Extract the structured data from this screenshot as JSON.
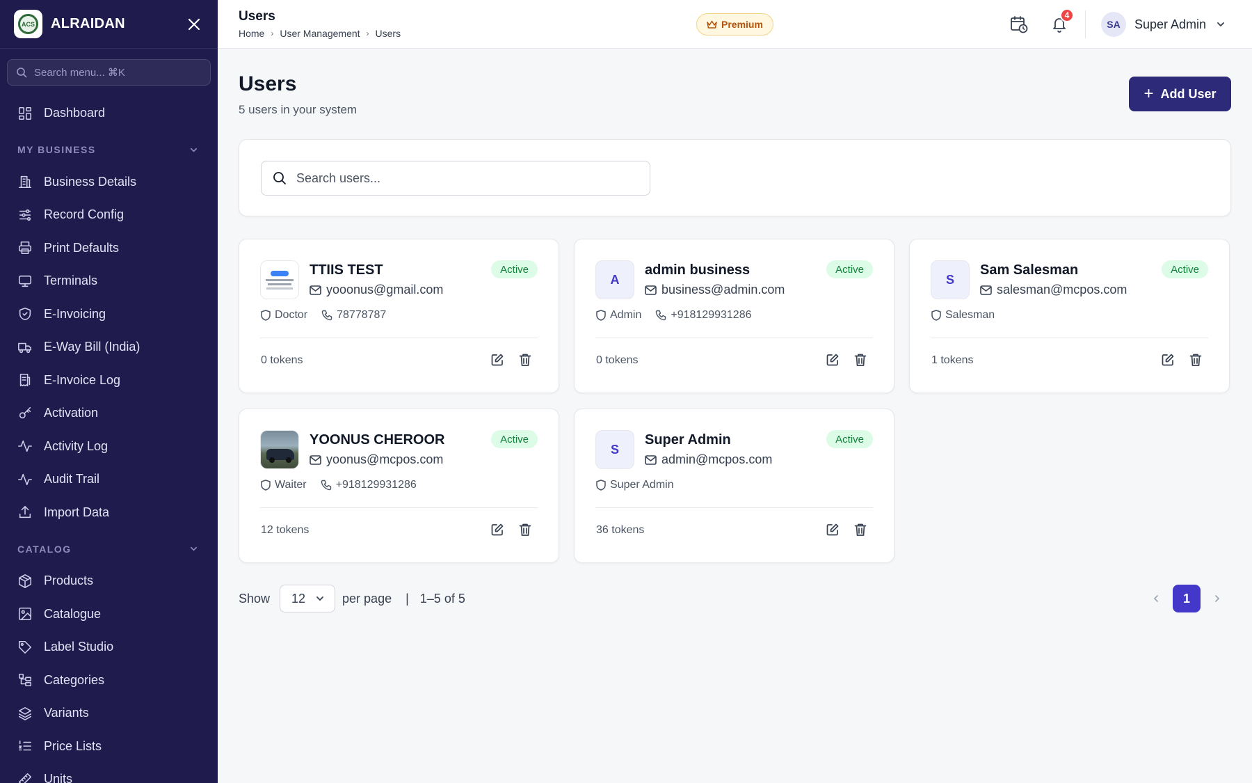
{
  "sidebar": {
    "brand": "ALRAIDAN",
    "search_placeholder": "Search menu... ⌘K",
    "top_items": [
      {
        "label": "Dashboard",
        "icon": "dashboard-icon"
      }
    ],
    "sections": [
      {
        "title": "MY BUSINESS",
        "items": [
          {
            "label": "Business Details",
            "icon": "building-icon"
          },
          {
            "label": "Record Config",
            "icon": "sliders-icon"
          },
          {
            "label": "Print Defaults",
            "icon": "printer-icon"
          },
          {
            "label": "Terminals",
            "icon": "monitor-icon"
          },
          {
            "label": "E-Invoicing",
            "icon": "shield-check-icon"
          },
          {
            "label": "E-Way Bill (India)",
            "icon": "truck-icon"
          },
          {
            "label": "E-Invoice Log",
            "icon": "receipt-icon"
          },
          {
            "label": "Activation",
            "icon": "key-icon"
          },
          {
            "label": "Activity Log",
            "icon": "activity-icon"
          },
          {
            "label": "Audit Trail",
            "icon": "activity-icon"
          },
          {
            "label": "Import Data",
            "icon": "upload-icon"
          }
        ]
      },
      {
        "title": "CATALOG",
        "items": [
          {
            "label": "Products",
            "icon": "box-icon"
          },
          {
            "label": "Catalogue",
            "icon": "image-icon"
          },
          {
            "label": "Label Studio",
            "icon": "tag-icon"
          },
          {
            "label": "Categories",
            "icon": "categories-icon"
          },
          {
            "label": "Variants",
            "icon": "layers-icon"
          },
          {
            "label": "Price Lists",
            "icon": "list-ordered-icon"
          },
          {
            "label": "Units",
            "icon": "ruler-icon"
          }
        ]
      }
    ]
  },
  "topbar": {
    "title": "Users",
    "breadcrumbs": [
      "Home",
      "User Management",
      "Users"
    ],
    "premium_label": "Premium",
    "notification_count": "4",
    "user_initials": "SA",
    "user_name": "Super Admin"
  },
  "page": {
    "title": "Users",
    "subtitle": "5 users in your system",
    "add_button": "Add User",
    "search_placeholder": "Search users..."
  },
  "users": [
    {
      "name": "TTIIS TEST",
      "email": "yooonus@gmail.com",
      "role": "Doctor",
      "phone": "78778787",
      "status": "Active",
      "tokens": "0 tokens",
      "avatar_initial": "",
      "avatar_type": "photo-card"
    },
    {
      "name": "admin business",
      "email": "business@admin.com",
      "role": "Admin",
      "phone": "+918129931286",
      "status": "Active",
      "tokens": "0 tokens",
      "avatar_initial": "A",
      "avatar_type": "initial"
    },
    {
      "name": "Sam Salesman",
      "email": "salesman@mcpos.com",
      "role": "Salesman",
      "phone": "",
      "status": "Active",
      "tokens": "1 tokens",
      "avatar_initial": "S",
      "avatar_type": "initial"
    },
    {
      "name": "YOONUS CHEROOR",
      "email": "yoonus@mcpos.com",
      "role": "Waiter",
      "phone": "+918129931286",
      "status": "Active",
      "tokens": "12 tokens",
      "avatar_initial": "",
      "avatar_type": "photo-car"
    },
    {
      "name": "Super Admin",
      "email": "admin@mcpos.com",
      "role": "Super Admin",
      "phone": "",
      "status": "Active",
      "tokens": "36 tokens",
      "avatar_initial": "S",
      "avatar_type": "initial"
    }
  ],
  "pagination": {
    "show_label": "Show",
    "per_page_value": "12",
    "per_page_label": "per page",
    "separator": "|",
    "range_label": "1–5 of 5",
    "current_page": "1"
  },
  "colors": {
    "sidebar_bg": "#1f1b4d",
    "primary": "#2e2a7a",
    "active_page": "#4338ca",
    "status_bg": "#dcfce7",
    "status_text": "#15803d",
    "badge": "#ef4444"
  }
}
